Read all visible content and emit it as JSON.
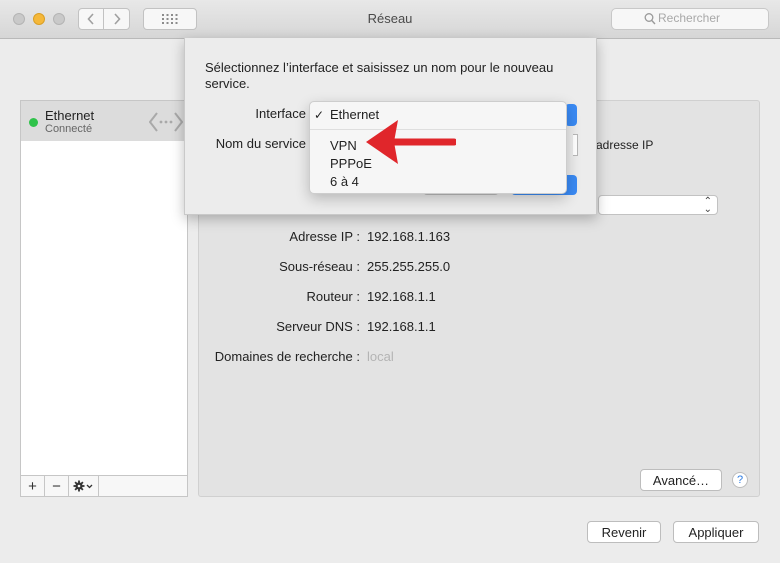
{
  "window": {
    "title": "Réseau"
  },
  "search": {
    "placeholder": "Rechercher"
  },
  "sidebar": {
    "services": [
      {
        "name": "Ethernet",
        "status": "Connecté",
        "status_color": "#2fc24a"
      }
    ],
    "controls": {
      "add": "+",
      "remove": "−"
    }
  },
  "details": {
    "partial_option": "adresse IP",
    "rows": [
      {
        "label": "Adresse IP :",
        "value": "192.168.1.163"
      },
      {
        "label": "Sous-réseau :",
        "value": "255.255.255.0"
      },
      {
        "label": "Routeur :",
        "value": "192.168.1.1"
      },
      {
        "label": "Serveur DNS :",
        "value": "192.168.1.1"
      },
      {
        "label": "Domaines de recherche :",
        "value": "local"
      }
    ],
    "advanced_button": "Avancé…",
    "help_button": "?"
  },
  "footer": {
    "revert_button": "Revenir",
    "apply_button": "Appliquer"
  },
  "sheet": {
    "message": "Sélectionnez l’interface et saisissez un nom pour le nouveau service.",
    "interface_label": "Interface",
    "service_name_label": "Nom du service"
  },
  "interface_menu": {
    "selected": "Ethernet",
    "check": "✓",
    "options": [
      "VPN",
      "PPPoE",
      "6 à 4"
    ]
  },
  "colors": {
    "accent": "#3a8af4",
    "arrow": "#e0262b",
    "connected": "#2fc24a"
  }
}
